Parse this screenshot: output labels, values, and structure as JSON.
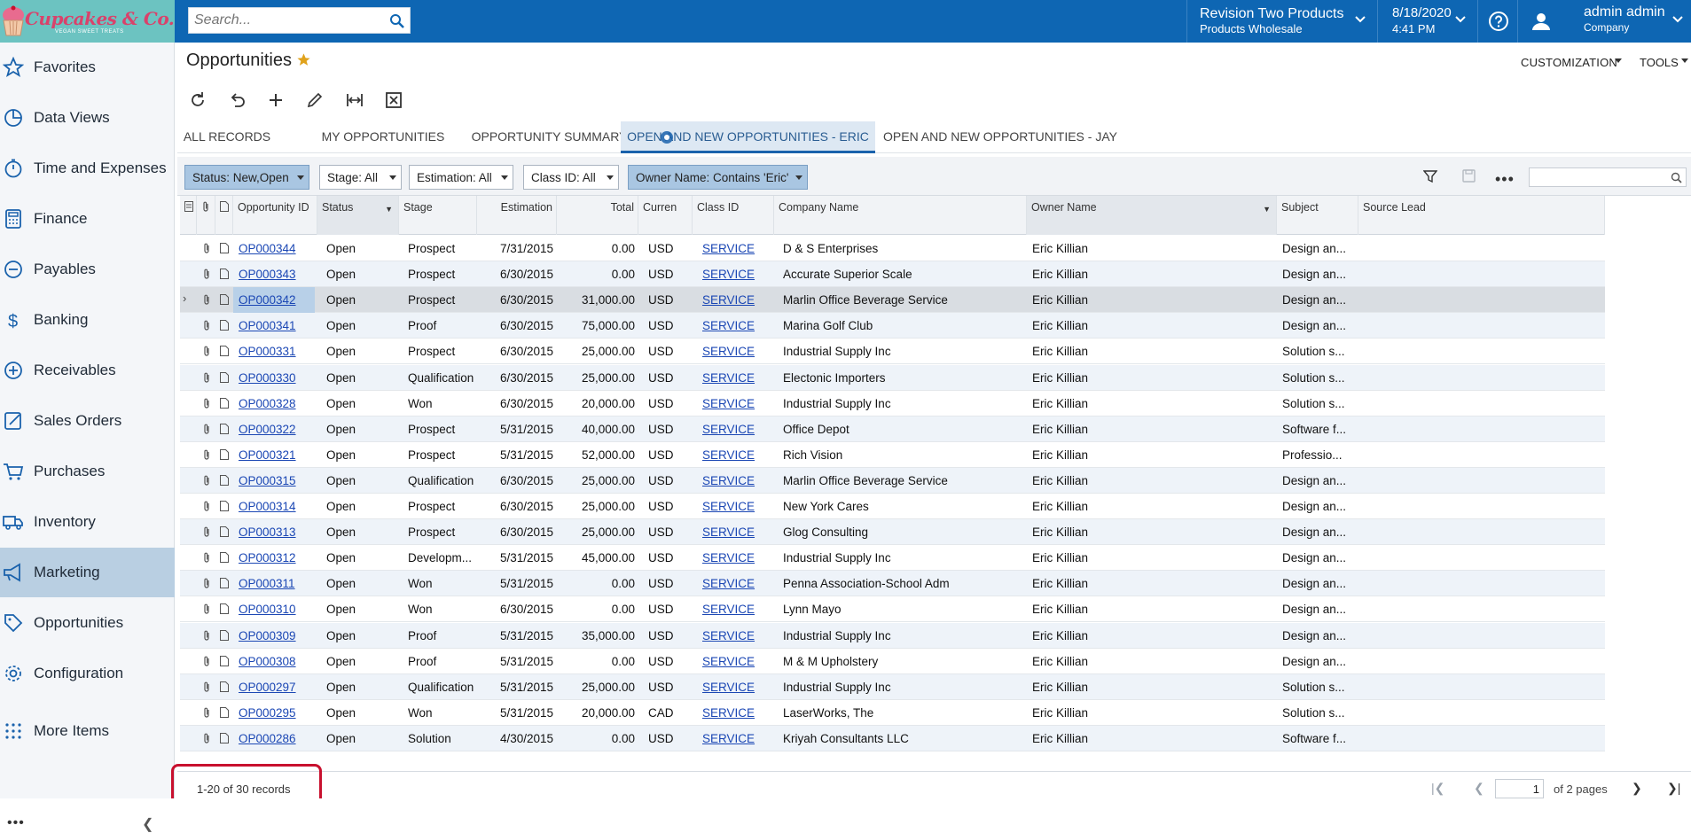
{
  "app": {
    "logo_text": "Cupcakes & Co.",
    "logo_tagline": "VEGAN SWEET TREATS",
    "search_placeholder": "Search...",
    "company": {
      "name": "Revision Two Products",
      "branch": "Products Wholesale"
    },
    "datetime": {
      "date": "8/18/2020",
      "time": "4:41 PM"
    },
    "user": {
      "name": "admin admin",
      "company": "Company"
    }
  },
  "sidebar": {
    "items": [
      {
        "label": "Favorites",
        "icon": "star-icon"
      },
      {
        "label": "Data Views",
        "icon": "pie-chart-icon"
      },
      {
        "label": "Time and Expenses",
        "icon": "stopwatch-icon"
      },
      {
        "label": "Finance",
        "icon": "calculator-icon"
      },
      {
        "label": "Payables",
        "icon": "minus-circle-icon"
      },
      {
        "label": "Banking",
        "icon": "dollar-icon"
      },
      {
        "label": "Receivables",
        "icon": "plus-circle-icon"
      },
      {
        "label": "Sales Orders",
        "icon": "edit-icon"
      },
      {
        "label": "Purchases",
        "icon": "cart-icon"
      },
      {
        "label": "Inventory",
        "icon": "truck-icon"
      },
      {
        "label": "Marketing",
        "icon": "megaphone-icon",
        "active": true
      },
      {
        "label": "Opportunities",
        "icon": "tag-icon"
      },
      {
        "label": "Configuration",
        "icon": "gear-icon"
      },
      {
        "label": "More Items",
        "icon": "grid-dots-icon"
      }
    ]
  },
  "page": {
    "title": "Opportunities",
    "customization": "CUSTOMIZATION",
    "tools": "TOOLS"
  },
  "tabs": [
    {
      "label": "ALL RECORDS"
    },
    {
      "label": "MY OPPORTUNITIES"
    },
    {
      "label": "OPPORTUNITY SUMMARY"
    },
    {
      "label": "OPEN AND NEW OPPORTUNITIES - ERIC",
      "active": true
    },
    {
      "label": "OPEN AND NEW OPPORTUNITIES - JAY"
    }
  ],
  "filters": [
    {
      "label": "Status: New,Open",
      "active": true
    },
    {
      "label": "Stage: All",
      "active": false
    },
    {
      "label": "Estimation: All",
      "active": false
    },
    {
      "label": "Class ID: All",
      "active": false
    },
    {
      "label": "Owner Name: Contains 'Eric'",
      "active": true
    }
  ],
  "grid": {
    "columns": {
      "id": "Opportunity ID",
      "status": "Status",
      "stage": "Stage",
      "estimation": "Estimation",
      "total": "Total",
      "currency": "Curren",
      "class": "Class ID",
      "company": "Company Name",
      "owner": "Owner Name",
      "subject": "Subject",
      "source": "Source Lead"
    },
    "rows": [
      {
        "id": "OP000344",
        "status": "Open",
        "stage": "Prospect",
        "estimation": "7/31/2015",
        "total": "0.00",
        "currency": "USD",
        "class": "SERVICE",
        "company": "D & S Enterprises",
        "owner": "Eric Killian",
        "subject": "Design an..."
      },
      {
        "id": "OP000343",
        "status": "Open",
        "stage": "Prospect",
        "estimation": "6/30/2015",
        "total": "0.00",
        "currency": "USD",
        "class": "SERVICE",
        "company": "Accurate Superior Scale",
        "owner": "Eric Killian",
        "subject": "Design an..."
      },
      {
        "id": "OP000342",
        "status": "Open",
        "stage": "Prospect",
        "estimation": "6/30/2015",
        "total": "31,000.00",
        "currency": "USD",
        "class": "SERVICE",
        "company": "Marlin Office Beverage Service",
        "owner": "Eric Killian",
        "subject": "Design an...",
        "selected": true
      },
      {
        "id": "OP000341",
        "status": "Open",
        "stage": "Proof",
        "estimation": "6/30/2015",
        "total": "75,000.00",
        "currency": "USD",
        "class": "SERVICE",
        "company": "Marina Golf Club",
        "owner": "Eric Killian",
        "subject": "Design an..."
      },
      {
        "id": "OP000331",
        "status": "Open",
        "stage": "Prospect",
        "estimation": "6/30/2015",
        "total": "25,000.00",
        "currency": "USD",
        "class": "SERVICE",
        "company": "Industrial Supply Inc",
        "owner": "Eric Killian",
        "subject": "Solution s..."
      },
      {
        "id": "OP000330",
        "status": "Open",
        "stage": "Qualification",
        "estimation": "6/30/2015",
        "total": "25,000.00",
        "currency": "USD",
        "class": "SERVICE",
        "company": "Electonic Importers",
        "owner": "Eric Killian",
        "subject": "Solution s..."
      },
      {
        "id": "OP000328",
        "status": "Open",
        "stage": "Won",
        "estimation": "6/30/2015",
        "total": "20,000.00",
        "currency": "USD",
        "class": "SERVICE",
        "company": "Industrial Supply Inc",
        "owner": "Eric Killian",
        "subject": "Solution s..."
      },
      {
        "id": "OP000322",
        "status": "Open",
        "stage": "Prospect",
        "estimation": "5/31/2015",
        "total": "40,000.00",
        "currency": "USD",
        "class": "SERVICE",
        "company": "Office Depot",
        "owner": "Eric Killian",
        "subject": "Software f..."
      },
      {
        "id": "OP000321",
        "status": "Open",
        "stage": "Prospect",
        "estimation": "5/31/2015",
        "total": "52,000.00",
        "currency": "USD",
        "class": "SERVICE",
        "company": "Rich Vision",
        "owner": "Eric Killian",
        "subject": "Professio..."
      },
      {
        "id": "OP000315",
        "status": "Open",
        "stage": "Qualification",
        "estimation": "6/30/2015",
        "total": "25,000.00",
        "currency": "USD",
        "class": "SERVICE",
        "company": "Marlin Office Beverage Service",
        "owner": "Eric Killian",
        "subject": "Design an..."
      },
      {
        "id": "OP000314",
        "status": "Open",
        "stage": "Prospect",
        "estimation": "6/30/2015",
        "total": "25,000.00",
        "currency": "USD",
        "class": "SERVICE",
        "company": "New York Cares",
        "owner": "Eric Killian",
        "subject": "Design an..."
      },
      {
        "id": "OP000313",
        "status": "Open",
        "stage": "Prospect",
        "estimation": "6/30/2015",
        "total": "25,000.00",
        "currency": "USD",
        "class": "SERVICE",
        "company": "Glog Consulting",
        "owner": "Eric Killian",
        "subject": "Design an..."
      },
      {
        "id": "OP000312",
        "status": "Open",
        "stage": "Developm...",
        "estimation": "5/31/2015",
        "total": "45,000.00",
        "currency": "USD",
        "class": "SERVICE",
        "company": "Industrial Supply Inc",
        "owner": "Eric Killian",
        "subject": "Design an..."
      },
      {
        "id": "OP000311",
        "status": "Open",
        "stage": "Won",
        "estimation": "5/31/2015",
        "total": "0.00",
        "currency": "USD",
        "class": "SERVICE",
        "company": "Penna Association-School Adm",
        "owner": "Eric Killian",
        "subject": "Design an..."
      },
      {
        "id": "OP000310",
        "status": "Open",
        "stage": "Won",
        "estimation": "6/30/2015",
        "total": "0.00",
        "currency": "USD",
        "class": "SERVICE",
        "company": "Lynn Mayo",
        "owner": "Eric Killian",
        "subject": "Design an..."
      },
      {
        "id": "OP000309",
        "status": "Open",
        "stage": "Proof",
        "estimation": "5/31/2015",
        "total": "35,000.00",
        "currency": "USD",
        "class": "SERVICE",
        "company": "Industrial Supply Inc",
        "owner": "Eric Killian",
        "subject": "Design an..."
      },
      {
        "id": "OP000308",
        "status": "Open",
        "stage": "Proof",
        "estimation": "5/31/2015",
        "total": "0.00",
        "currency": "USD",
        "class": "SERVICE",
        "company": "M & M Upholstery",
        "owner": "Eric Killian",
        "subject": "Design an..."
      },
      {
        "id": "OP000297",
        "status": "Open",
        "stage": "Qualification",
        "estimation": "5/31/2015",
        "total": "25,000.00",
        "currency": "USD",
        "class": "SERVICE",
        "company": "Industrial Supply Inc",
        "owner": "Eric Killian",
        "subject": "Solution s..."
      },
      {
        "id": "OP000295",
        "status": "Open",
        "stage": "Won",
        "estimation": "5/31/2015",
        "total": "20,000.00",
        "currency": "CAD",
        "class": "SERVICE",
        "company": "LaserWorks, The",
        "owner": "Eric Killian",
        "subject": "Solution s..."
      },
      {
        "id": "OP000286",
        "status": "Open",
        "stage": "Solution",
        "estimation": "4/30/2015",
        "total": "0.00",
        "currency": "USD",
        "class": "SERVICE",
        "company": "Kriyah Consultants LLC",
        "owner": "Eric Killian",
        "subject": "Software f..."
      }
    ]
  },
  "footer": {
    "records": "1-20 of 30 records",
    "page": "1",
    "of_pages": "of 2 pages"
  },
  "colors": {
    "topbar": "#0e66b3",
    "logo_bg": "#6cc3c1",
    "highlight_box": "#c8102e",
    "link": "#1b47b4"
  }
}
